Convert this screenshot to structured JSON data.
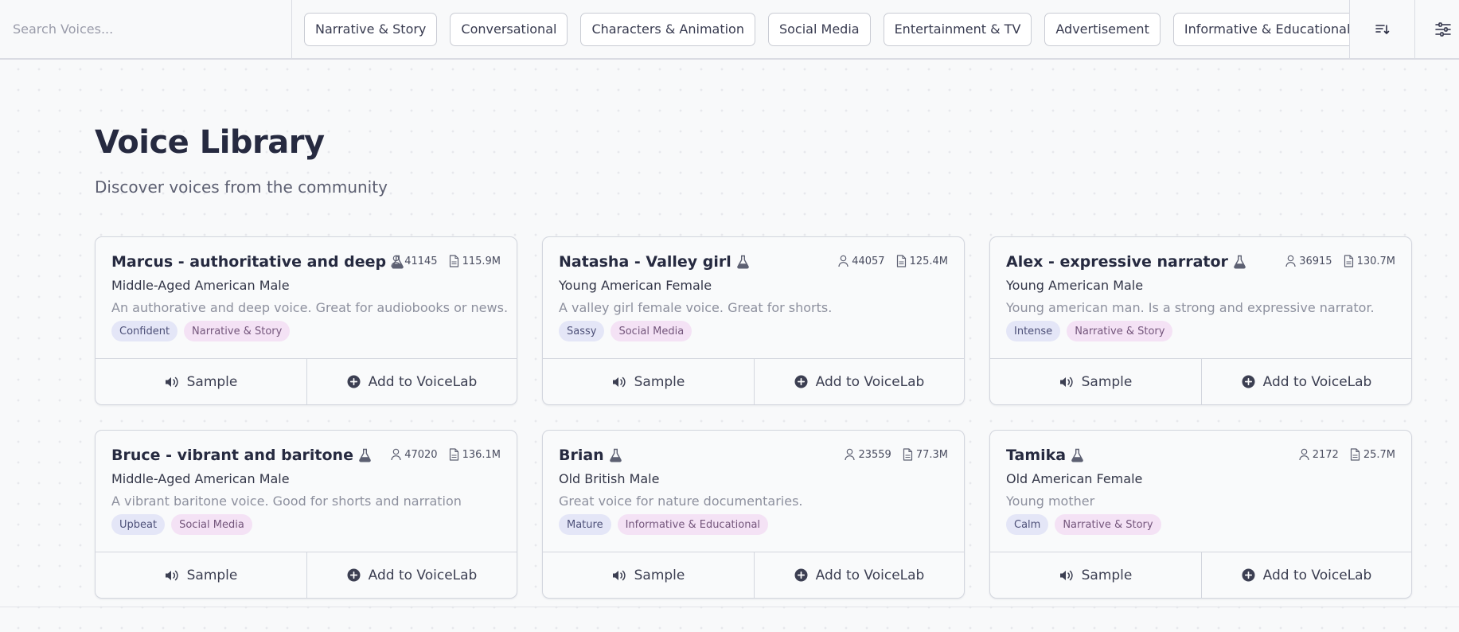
{
  "search": {
    "placeholder": "Search Voices..."
  },
  "filters": [
    "Narrative & Story",
    "Conversational",
    "Characters & Animation",
    "Social Media",
    "Entertainment & TV",
    "Advertisement",
    "Informative & Educational"
  ],
  "header": {
    "title": "Voice Library",
    "subtitle": "Discover voices from the community"
  },
  "actions": {
    "sample": "Sample",
    "add": "Add to VoiceLab"
  },
  "voices": [
    {
      "name": "Marcus - authoritative and deep",
      "users": "41145",
      "chars": "115.9M",
      "profile": "Middle-Aged American Male",
      "description": "An authorative and deep voice. Great for audiobooks or news.",
      "mood": "Confident",
      "category": "Narrative & Story"
    },
    {
      "name": "Natasha - Valley girl",
      "users": "44057",
      "chars": "125.4M",
      "profile": "Young American Female",
      "description": "A valley girl female voice. Great for shorts.",
      "mood": "Sassy",
      "category": "Social Media"
    },
    {
      "name": "Alex - expressive narrator",
      "users": "36915",
      "chars": "130.7M",
      "profile": "Young American Male",
      "description": "Young american man. Is a strong and expressive narrator.",
      "mood": "Intense",
      "category": "Narrative & Story"
    },
    {
      "name": "Bruce - vibrant and baritone",
      "users": "47020",
      "chars": "136.1M",
      "profile": "Middle-Aged American Male",
      "description": "A vibrant baritone voice. Good for shorts and narration",
      "mood": "Upbeat",
      "category": "Social Media"
    },
    {
      "name": "Brian",
      "users": "23559",
      "chars": "77.3M",
      "profile": "Old British Male",
      "description": "Great voice for nature documentaries.",
      "mood": "Mature",
      "category": "Informative & Educational"
    },
    {
      "name": "Tamika",
      "users": "2172",
      "chars": "25.7M",
      "profile": "Old American Female",
      "description": "Young mother",
      "mood": "Calm",
      "category": "Narrative & Story"
    }
  ],
  "icons": {
    "flask": "flask-icon",
    "users": "user-icon",
    "chars": "document-icon",
    "sample": "speaker-icon",
    "add": "plus-circle-icon",
    "sort": "sort-icon",
    "settings": "sliders-icon"
  },
  "colors": {
    "accent_mood_bg": "#e4e6f7",
    "accent_category_bg": "#f4e2f5",
    "text_primary": "#262a40",
    "text_muted": "#8d909e"
  }
}
